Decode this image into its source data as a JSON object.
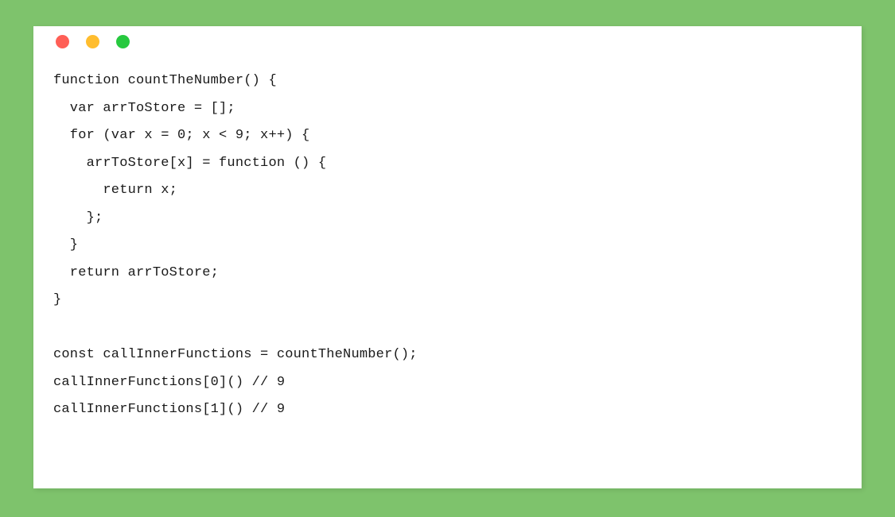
{
  "theme": {
    "background_color": "#7EC36C",
    "card_color": "#FFFFFF",
    "code_text_color": "#1A1A1A"
  },
  "window": {
    "titlebar": {
      "dots": [
        {
          "name": "close",
          "color": "#FF5F56"
        },
        {
          "name": "minimize",
          "color": "#FFBD2E"
        },
        {
          "name": "maximize",
          "color": "#27C93F"
        }
      ]
    }
  },
  "code": {
    "language": "javascript",
    "lines": [
      "function countTheNumber() {",
      "  var arrToStore = [];",
      "  for (var x = 0; x < 9; x++) {",
      "    arrToStore[x] = function () {",
      "      return x;",
      "    };",
      "  }",
      "  return arrToStore;",
      "}",
      "",
      "const callInnerFunctions = countTheNumber();",
      "callInnerFunctions[0]() // 9",
      "callInnerFunctions[1]() // 9"
    ]
  }
}
